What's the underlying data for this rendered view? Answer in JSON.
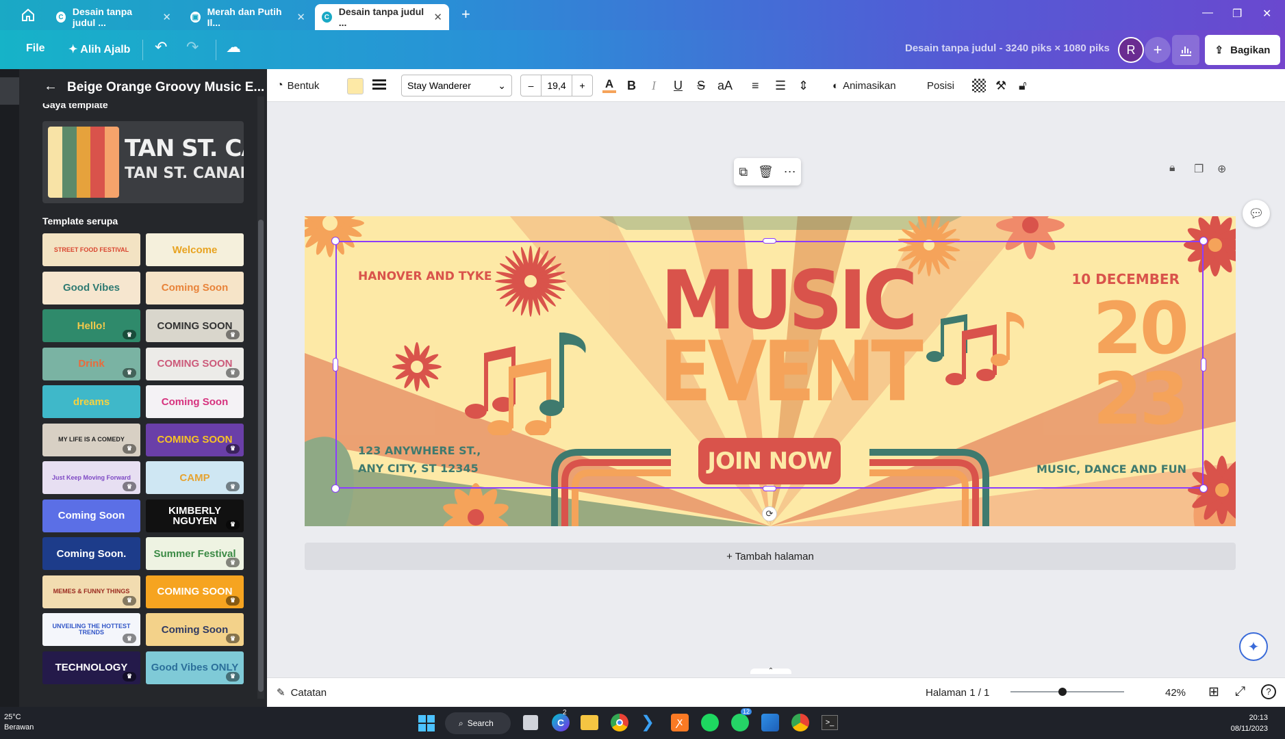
{
  "browser": {
    "tabs": [
      {
        "label": "Desain tanpa judul ..."
      },
      {
        "label": "Merah dan Putih Il..."
      },
      {
        "label": "Desain tanpa judul ..."
      }
    ]
  },
  "menubar": {
    "file": "File",
    "resize": "Alih Ajalb",
    "doc_title": "Desain tanpa judul - 3240 piks × 1080 piks",
    "avatar": "R",
    "share": "Bagikan"
  },
  "panel": {
    "title": "Beige Orange Groovy Music E...",
    "style_heading": "Gaya template",
    "style_text_1": "TAN ST. CAN",
    "style_text_2": "TAN ST. CANAR",
    "palette": [
      "#f8e3a6",
      "#5c8a6a",
      "#e6a23c",
      "#d9534b",
      "#f5a36b"
    ],
    "similar_heading": "Template serupa",
    "templates": [
      {
        "label": "STREET FOOD FESTIVAL",
        "bg": "#f3e3c3",
        "fg": "#d9452f",
        "premium": false
      },
      {
        "label": "Welcome",
        "bg": "#f5f0dc",
        "fg": "#e8a321",
        "premium": false
      },
      {
        "label": "Good Vibes",
        "bg": "#f6e6cf",
        "fg": "#2f7a72",
        "premium": false
      },
      {
        "label": "Coming Soon",
        "bg": "#f6e4c8",
        "fg": "#e8833a",
        "premium": false
      },
      {
        "label": "Hello!",
        "bg": "#2f8a6b",
        "fg": "#f2c94c",
        "premium": true
      },
      {
        "label": "COMING SOON",
        "bg": "#d9d6cc",
        "fg": "#333333",
        "premium": true
      },
      {
        "label": "Drink",
        "bg": "#7ab3a3",
        "fg": "#e96b3c",
        "premium": true
      },
      {
        "label": "COMING SOON",
        "bg": "#ecebe8",
        "fg": "#cc5a7a",
        "premium": true
      },
      {
        "label": "dreams",
        "bg": "#3fb8c9",
        "fg": "#f7d23e",
        "premium": false
      },
      {
        "label": "Coming Soon",
        "bg": "#f4f2f5",
        "fg": "#d6327e",
        "premium": false
      },
      {
        "label": "MY LIFE IS A COMEDY",
        "bg": "#d8d0c4",
        "fg": "#222222",
        "premium": true
      },
      {
        "label": "COMING SOON",
        "bg": "#6a3fa8",
        "fg": "#f7c325",
        "premium": true
      },
      {
        "label": "Just Keep Moving Forward",
        "bg": "#e7dff2",
        "fg": "#7e49c4",
        "premium": true
      },
      {
        "label": "CAMP",
        "bg": "#cfe7f3",
        "fg": "#e5a331",
        "premium": true
      },
      {
        "label": "Coming Soon",
        "bg": "#5b6fe6",
        "fg": "#ffffff",
        "premium": false
      },
      {
        "label": "KIMBERLY NGUYEN",
        "bg": "#111111",
        "fg": "#ffffff",
        "premium": true
      },
      {
        "label": "Coming Soon.",
        "bg": "#1d3c8a",
        "fg": "#ffffff",
        "premium": false
      },
      {
        "label": "Summer Festival",
        "bg": "#eef3e2",
        "fg": "#3b8a45",
        "premium": true
      },
      {
        "label": "MEMES & FUNNY THINGS",
        "bg": "#f2dcb0",
        "fg": "#9a2a1f",
        "premium": true
      },
      {
        "label": "COMING SOON",
        "bg": "#f6a420",
        "fg": "#ffffff",
        "premium": true
      },
      {
        "label": "UNVEILING THE HOTTEST TRENDS",
        "bg": "#f4f6fb",
        "fg": "#3155c7",
        "premium": true
      },
      {
        "label": "Coming Soon",
        "bg": "#f3d28a",
        "fg": "#2f3a63",
        "premium": true
      },
      {
        "label": "TECHNOLOGY",
        "bg": "#241a4a",
        "fg": "#ffffff",
        "premium": true
      },
      {
        "label": "Good Vibes ONLY",
        "bg": "#7fcad7",
        "fg": "#2b6f9a",
        "premium": true
      }
    ]
  },
  "toolbar": {
    "shape": "Bentuk",
    "color_swatch": "#fde9a6",
    "font": "Stay Wanderer",
    "font_size": "19,4",
    "minus": "–",
    "plus": "+",
    "animate": "Animasikan",
    "position": "Posisi"
  },
  "design": {
    "top_left": "HANOVER AND TYKE",
    "top_right": "10 DECEMBER",
    "title_1": "MUSIC",
    "title_2": "EVENT",
    "year_1": "20",
    "year_2": "23",
    "address": "123 ANYWHERE ST., ANY CITY, ST 12345",
    "cta": "JOIN NOW",
    "tagline": "MUSIC, DANCE AND FUN",
    "bg": "#fde9a6",
    "red": "#d9534b",
    "orange": "#f5a35a",
    "teal": "#3f7a6e"
  },
  "canvas": {
    "add_page": "+ Tambah halaman"
  },
  "footer": {
    "notes": "Catatan",
    "page": "Halaman 1 / 1",
    "zoom": "42%",
    "zoom_level": 0.42
  },
  "taskbar": {
    "weather_temp": "25°C",
    "weather_desc": "Berawan",
    "search": "Search",
    "time": "20:13",
    "date": "08/11/2023",
    "badge_canva": "2",
    "badge_whatsapp": "12"
  }
}
